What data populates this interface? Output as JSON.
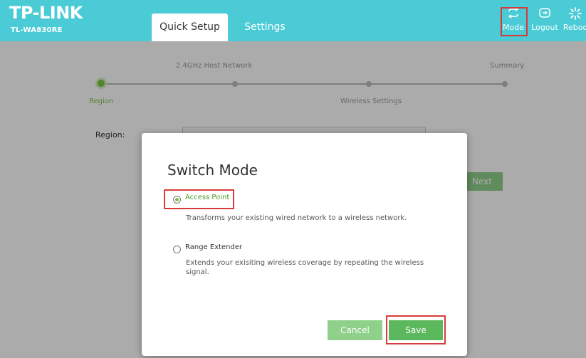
{
  "header": {
    "brand": "TP-LINK",
    "model": "TL-WA830RE",
    "tabs": [
      {
        "label": "Quick Setup",
        "active": true
      },
      {
        "label": "Settings",
        "active": false
      }
    ],
    "tools": [
      {
        "label": "Mode",
        "icon": "switch-arrows-icon"
      },
      {
        "label": "Logout",
        "icon": "logout-icon"
      },
      {
        "label": "Reboo",
        "icon": "reboot-icon"
      }
    ]
  },
  "wizard": {
    "top_steps": [
      "2.4GHz Host Network",
      "Summary"
    ],
    "bottom_steps": [
      "Region",
      "Wireless Settings"
    ],
    "region_label": "Region:",
    "next_label": "Next"
  },
  "modal": {
    "title": "Switch Mode",
    "options": [
      {
        "label": "Access Point",
        "selected": true,
        "description": "Transforms your existing wired network to a wireless network."
      },
      {
        "label": "Range Extender",
        "selected": false,
        "description": "Extends your exisiting wireless coverage by repeating the wireless signal."
      }
    ],
    "cancel_label": "Cancel",
    "save_label": "Save"
  },
  "colors": {
    "header_bg": "#4acbd6",
    "accent_green": "#7bc242",
    "button_green": "#5cb85c",
    "highlight_red": "#d93b3b"
  }
}
